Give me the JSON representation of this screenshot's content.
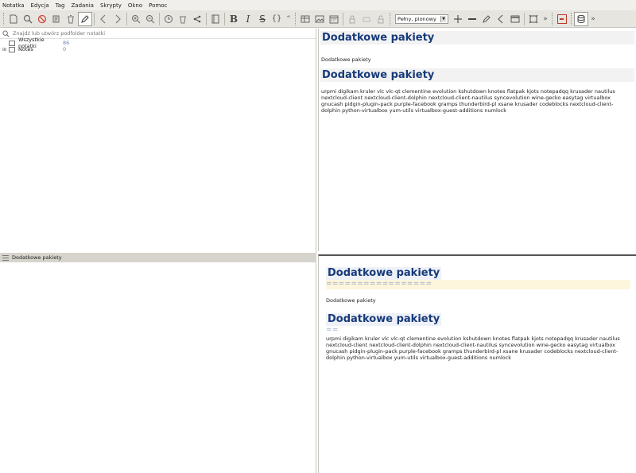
{
  "menu": [
    "Notatka",
    "Edycja",
    "Tag",
    "Zadania",
    "Skrypty",
    "Okno",
    "Pomoc"
  ],
  "toolbar": {
    "view_mode": "Pełny, pionowy",
    "bold": "B",
    "italic": "I",
    "strike": "S",
    "code": "{}",
    "quote": "“",
    "overflow": "»",
    "arrow": "▼"
  },
  "search": {
    "placeholder": "Znajdź lub utwórz podfolder notatki"
  },
  "tree": [
    {
      "label": "Wszystkie notatki",
      "count": "86",
      "expander": ""
    },
    {
      "label": "Notes",
      "count": "0",
      "expander": "⊞"
    }
  ],
  "note_list_header": "Dodatkowe pakiety",
  "preview": {
    "heading1": "Dodatkowe pakiety",
    "para1": "Dodatkowe pakiety",
    "heading2": "Dodatkowe pakiety",
    "para2": "urpmi digikam kruler vlc vlc-qt clementine evolution kshutdown knotes flatpak kjots notepadqq krusader nautilus nextcloud-client nextcloud-client-dolphin nextcloud-client-nautilus syncevolution wine-gecko easytag virtualbox gnucash pidgin-plugin-pack purple-facebook gramps thunderbird-pl xsane krusader codeblocks nextcloud-client-dolphin python-virtualbox yum-utils virtualbox-guest-additions numlock"
  },
  "editor": {
    "heading1": "Dodatkowe pakiety",
    "underline1": "=================",
    "para1": "Dodatkowe pakiety",
    "heading2": "Dodatkowe pakiety",
    "underline2": "==",
    "para2": "urpmi digikam kruler vlc vlc-qt clementine evolution kshutdown knotes flatpak kjots notepadqq krusader nautilus nextcloud-client nextcloud-client-dolphin nextcloud-client-nautilus syncevolution wine-gecko easytag virtualbox gnucash pidgin-plugin-pack purple-facebook gramps thunderbird-pl xsane krusader codeblocks nextcloud-client-dolphin python-virtualbox yum-utils virtualbox-guest-additions numlock"
  },
  "colors": {
    "heading": "#173a7a",
    "toolbar_bg": "#e7e5e0",
    "count": "#6b86b8",
    "underline_bg": "#fdf6dc"
  }
}
